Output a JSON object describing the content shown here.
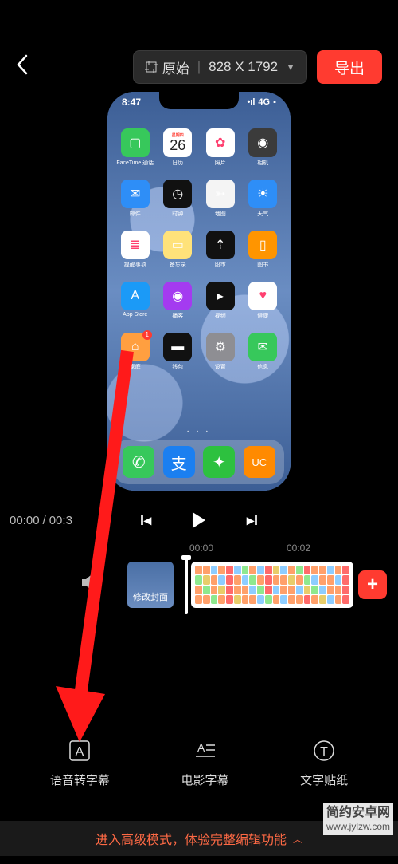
{
  "topbar": {
    "aspect_label": "原始",
    "resolution": "828 X 1792",
    "export_label": "导出"
  },
  "preview_phone": {
    "time": "8:47",
    "signal": "4G",
    "calendar": {
      "weekday": "星期四",
      "day": "26"
    },
    "apps": [
      {
        "label": "FaceTime 通话",
        "bg": "#37c85b",
        "glyph": "▢"
      },
      {
        "label": "日历",
        "bg": "#ffffff",
        "glyph": "",
        "is_calendar": true
      },
      {
        "label": "照片",
        "bg": "#ffffff",
        "glyph": "✿"
      },
      {
        "label": "相机",
        "bg": "#3b3b3b",
        "glyph": "◉"
      },
      {
        "label": "邮件",
        "bg": "#2e8ef7",
        "glyph": "✉"
      },
      {
        "label": "时钟",
        "bg": "#111111",
        "glyph": "◷"
      },
      {
        "label": "地图",
        "bg": "#f4f4f4",
        "glyph": "➳"
      },
      {
        "label": "天气",
        "bg": "#2e8ef7",
        "glyph": "☀"
      },
      {
        "label": "提醒事项",
        "bg": "#ffffff",
        "glyph": "≣"
      },
      {
        "label": "备忘录",
        "bg": "#ffe27a",
        "glyph": "▭"
      },
      {
        "label": "股市",
        "bg": "#111111",
        "glyph": "⇡"
      },
      {
        "label": "图书",
        "bg": "#ff9500",
        "glyph": "▯"
      },
      {
        "label": "App Store",
        "bg": "#1b9af7",
        "glyph": "A"
      },
      {
        "label": "播客",
        "bg": "#a43bf0",
        "glyph": "◉"
      },
      {
        "label": "视频",
        "bg": "#111111",
        "glyph": "▸"
      },
      {
        "label": "健康",
        "bg": "#ffffff",
        "glyph": "♥"
      },
      {
        "label": "家庭",
        "bg": "#ff9f40",
        "glyph": "⌂",
        "badge": "1"
      },
      {
        "label": "钱包",
        "bg": "#111111",
        "glyph": "▬"
      },
      {
        "label": "设置",
        "bg": "#8e8e93",
        "glyph": "⚙"
      },
      {
        "label": "信息",
        "bg": "#37c85b",
        "glyph": "✉"
      }
    ],
    "dock": [
      {
        "name": "phone",
        "bg": "#37c85b",
        "glyph": "✆"
      },
      {
        "name": "alipay",
        "bg": "#1b7ff0",
        "glyph": "支"
      },
      {
        "name": "wechat",
        "bg": "#2dc13f",
        "glyph": "✦"
      },
      {
        "name": "uc",
        "bg": "#ff8a00",
        "glyph": "UC"
      }
    ]
  },
  "playback": {
    "current": "00:00",
    "total": "00:3"
  },
  "ruler": {
    "t0": "00:00",
    "t1": "00:02"
  },
  "timeline": {
    "cover_label": "修改封面"
  },
  "tools": [
    {
      "id": "voice-subtitle",
      "label": "语音转字幕"
    },
    {
      "id": "movie-subtitle",
      "label": "电影字幕"
    },
    {
      "id": "text-sticker",
      "label": "文字贴纸"
    }
  ],
  "banner": "进入高级模式，体验完整编辑功能",
  "watermark": {
    "line1": "简约安卓网",
    "line2": "www.jylzw.com"
  }
}
